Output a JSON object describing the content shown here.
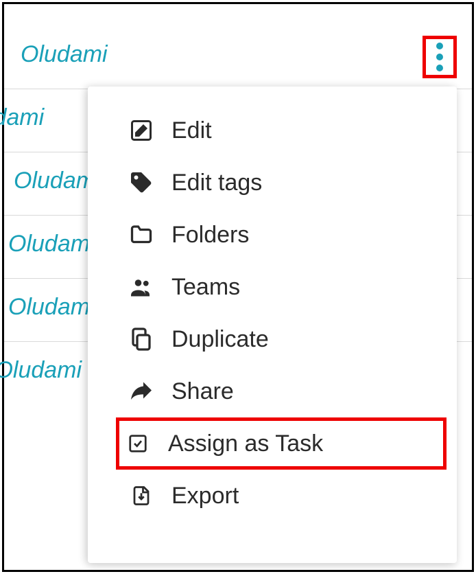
{
  "list": {
    "items": [
      {
        "name": "Oludami"
      },
      {
        "name": "ludami"
      },
      {
        "name": "Oludami"
      },
      {
        "name": "Oludami"
      },
      {
        "name": "Oludami"
      },
      {
        "name": "y Oludami"
      }
    ]
  },
  "menu": {
    "items": [
      {
        "icon": "edit-icon",
        "label": "Edit"
      },
      {
        "icon": "tag-icon",
        "label": "Edit tags"
      },
      {
        "icon": "folder-icon",
        "label": "Folders"
      },
      {
        "icon": "teams-icon",
        "label": "Teams"
      },
      {
        "icon": "duplicate-icon",
        "label": "Duplicate"
      },
      {
        "icon": "share-icon",
        "label": "Share"
      },
      {
        "icon": "task-icon",
        "label": "Assign as Task",
        "highlighted": true
      },
      {
        "icon": "export-icon",
        "label": "Export"
      }
    ]
  }
}
